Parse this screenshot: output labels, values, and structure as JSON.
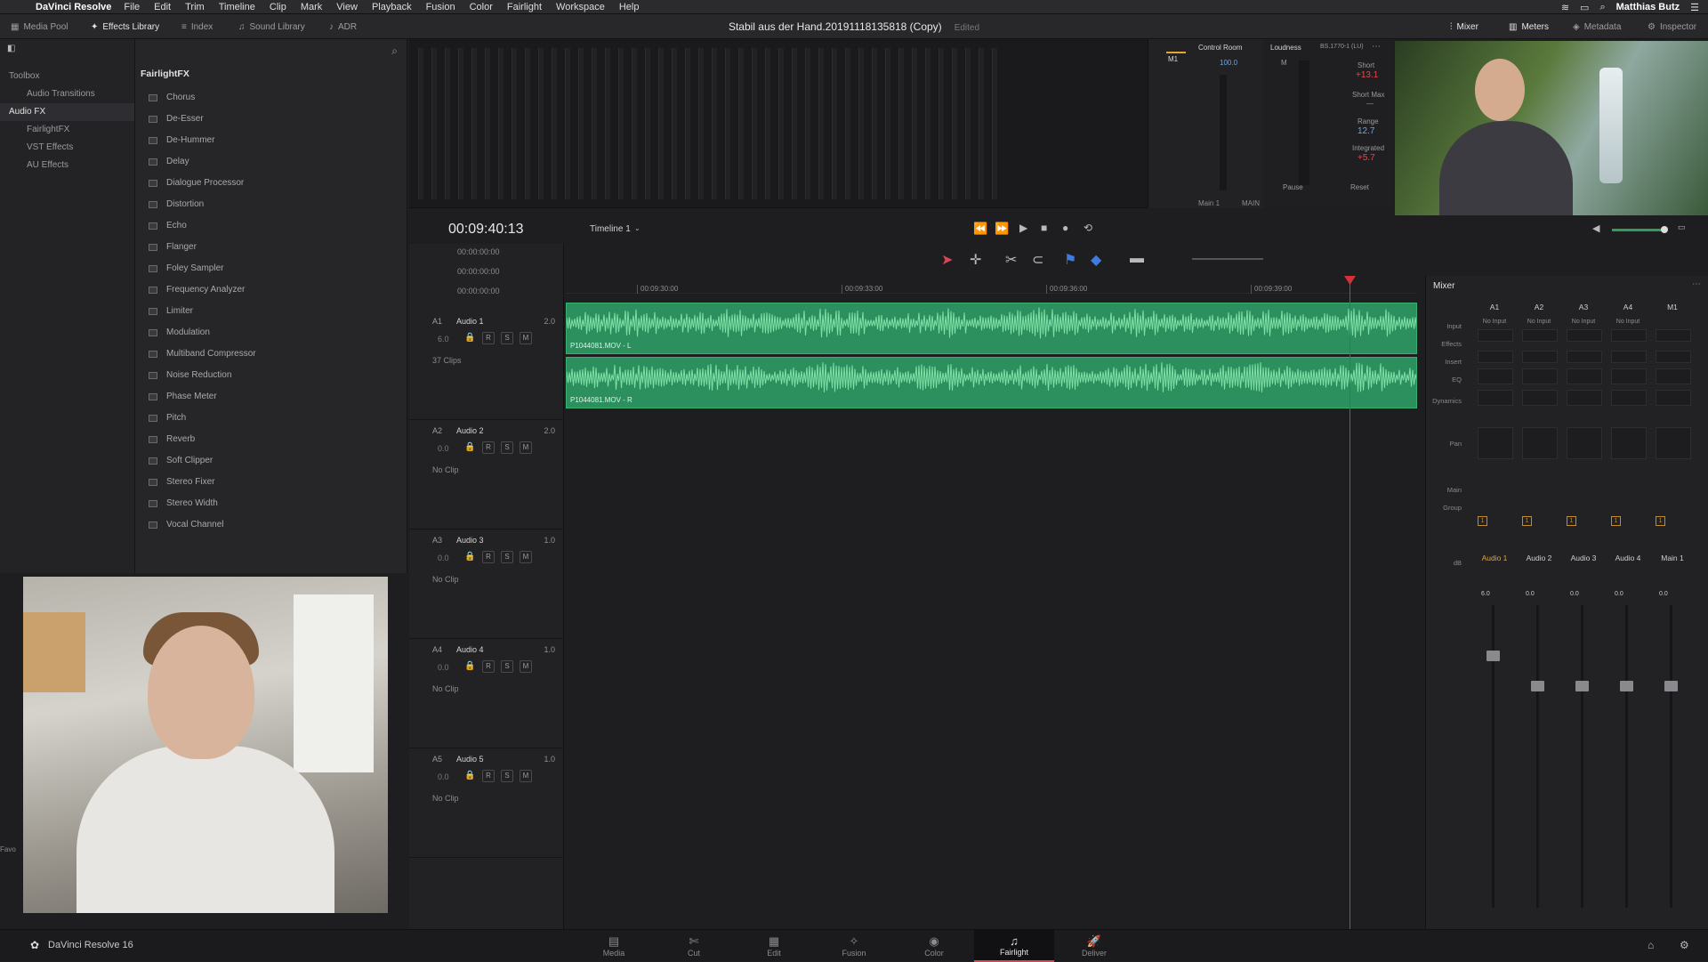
{
  "menubar": {
    "app_name": "DaVinci Resolve",
    "menus": [
      "File",
      "Edit",
      "Trim",
      "Timeline",
      "Clip",
      "Mark",
      "View",
      "Playback",
      "Fusion",
      "Color",
      "Fairlight",
      "Workspace",
      "Help"
    ],
    "user": "Matthias Butz"
  },
  "toolbar": {
    "left": [
      {
        "label": "Media Pool",
        "icon": "media-pool-icon"
      },
      {
        "label": "Effects Library",
        "icon": "effects-library-icon"
      },
      {
        "label": "Index",
        "icon": "index-icon"
      },
      {
        "label": "Sound Library",
        "icon": "sound-library-icon"
      },
      {
        "label": "ADR",
        "icon": "adr-icon"
      }
    ],
    "project_title": "Stabil aus der Hand.20191118135818 (Copy)",
    "edited_label": "Edited",
    "right": [
      {
        "label": "Mixer",
        "icon": "mixer-icon"
      },
      {
        "label": "Meters",
        "icon": "meters-icon"
      },
      {
        "label": "Metadata",
        "icon": "metadata-icon"
      },
      {
        "label": "Inspector",
        "icon": "inspector-icon"
      }
    ]
  },
  "toolbox": {
    "items": [
      {
        "label": "Toolbox",
        "level": 0
      },
      {
        "label": "Audio Transitions",
        "level": 1
      },
      {
        "label": "Audio FX",
        "level": 0,
        "selected": true
      },
      {
        "label": "FairlightFX",
        "level": 1
      },
      {
        "label": "VST Effects",
        "level": 1
      },
      {
        "label": "AU Effects",
        "level": 1
      }
    ]
  },
  "fx_panel": {
    "title": "FairlightFX",
    "items": [
      "Chorus",
      "De-Esser",
      "De-Hummer",
      "Delay",
      "Dialogue Processor",
      "Distortion",
      "Echo",
      "Flanger",
      "Foley Sampler",
      "Frequency Analyzer",
      "Limiter",
      "Modulation",
      "Multiband Compressor",
      "Noise Reduction",
      "Phase Meter",
      "Pitch",
      "Reverb",
      "Soft Clipper",
      "Stereo Fixer",
      "Stereo Width",
      "Vocal Channel"
    ]
  },
  "favorites_label": "Favo",
  "control_room": {
    "title": "Control Room",
    "bus": "M1",
    "level": "100.0",
    "main_label": "Main 1",
    "main_select": "MAIN"
  },
  "loudness": {
    "title": "Loudness",
    "standard": "BS.1770-1 (LU)",
    "channel": "M",
    "short_label": "Short",
    "short_value": "+13.1",
    "short_max_label": "Short Max",
    "short_max_value": "—",
    "range_label": "Range",
    "range_value": "12.7",
    "integrated_label": "Integrated",
    "integrated_value": "+5.7",
    "pause_label": "Pause",
    "reset_label": "Reset"
  },
  "timeline": {
    "timecode": "00:09:40:13",
    "name": "Timeline 1",
    "small_times": [
      "00:00:00:00",
      "00:00:00:00",
      "00:00:00:00"
    ],
    "ruler": [
      "00:09:30:00",
      "00:09:33:00",
      "00:09:36:00",
      "00:09:39:00"
    ]
  },
  "tracks": [
    {
      "id": "A1",
      "name": "Audio 1",
      "ch": "2.0",
      "vol": "6.0",
      "info": "37 Clips"
    },
    {
      "id": "A2",
      "name": "Audio 2",
      "ch": "2.0",
      "vol": "0.0",
      "info": "No Clip"
    },
    {
      "id": "A3",
      "name": "Audio 3",
      "ch": "1.0",
      "vol": "0.0",
      "info": "No Clip"
    },
    {
      "id": "A4",
      "name": "Audio 4",
      "ch": "1.0",
      "vol": "0.0",
      "info": "No Clip"
    },
    {
      "id": "A5",
      "name": "Audio 5",
      "ch": "1.0",
      "vol": "0.0",
      "info": "No Clip"
    }
  ],
  "track_buttons": {
    "r": "R",
    "s": "S",
    "m": "M"
  },
  "clips": [
    {
      "label": "P1044081.MOV - L"
    },
    {
      "label": "P1044081.MOV - R"
    }
  ],
  "mixer": {
    "title": "Mixer",
    "row_labels": [
      "Input",
      "Effects",
      "Insert",
      "EQ",
      "Dynamics",
      "Pan",
      "Main",
      "Group",
      "dB"
    ],
    "main_btn": "1",
    "channels": [
      {
        "id": "A1",
        "input": "No Input",
        "name": "Audio 1",
        "db": "6.0",
        "selected": true,
        "fader_level": 0.15
      },
      {
        "id": "A2",
        "input": "No Input",
        "name": "Audio 2",
        "db": "0.0",
        "fader_level": 0.25
      },
      {
        "id": "A3",
        "input": "No Input",
        "name": "Audio 3",
        "db": "0.0",
        "fader_level": 0.25
      },
      {
        "id": "A4",
        "input": "No Input",
        "name": "Audio 4",
        "db": "0.0",
        "fader_level": 0.25
      },
      {
        "id": "M1",
        "input": "",
        "name": "Main 1",
        "db": "0.0",
        "fader_level": 0.25
      }
    ]
  },
  "status": {
    "app_version": "DaVinci Resolve 16",
    "pages": [
      "Media",
      "Cut",
      "Edit",
      "Fusion",
      "Color",
      "Fairlight",
      "Deliver"
    ],
    "active_page": "Fairlight"
  },
  "colors": {
    "accent": "#d64856",
    "clip": "#2c8f5e",
    "playhead": "#d3303a",
    "selected": "#e4a630"
  }
}
